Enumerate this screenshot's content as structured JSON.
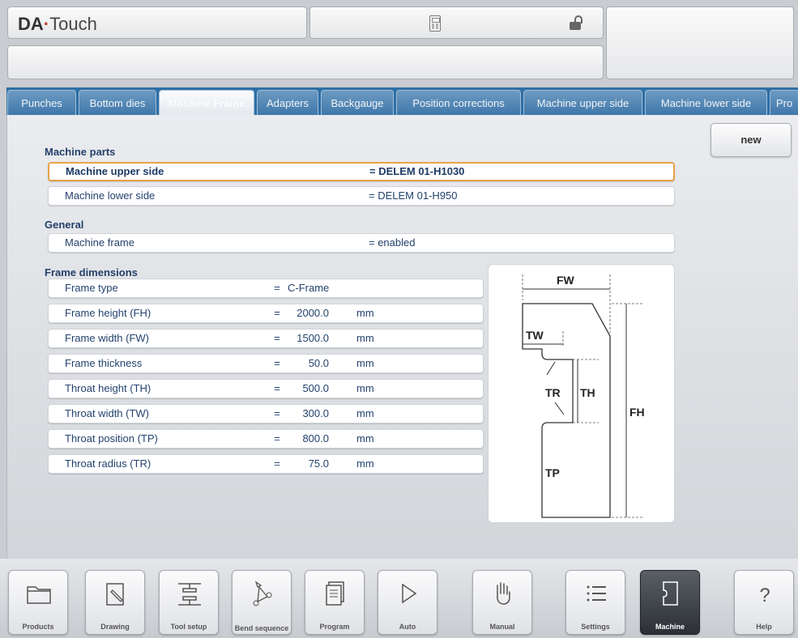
{
  "header": {
    "logo_brand": "DA",
    "logo_separator": "·",
    "logo_product": "Touch",
    "calculator_icon": "calculator-icon",
    "lock_icon": "unlocked-padlock-icon"
  },
  "tabs": [
    {
      "label": "Punches",
      "active": false
    },
    {
      "label": "Bottom dies",
      "active": false
    },
    {
      "label": "Machine Frame",
      "active": true
    },
    {
      "label": "Adapters",
      "active": false
    },
    {
      "label": "Backgauge",
      "active": false
    },
    {
      "label": "Position corrections",
      "active": false
    },
    {
      "label": "Machine upper side",
      "active": false
    },
    {
      "label": "Machine lower side",
      "active": false
    },
    {
      "label": "Pro",
      "active": false
    }
  ],
  "new_button": "new",
  "sections": {
    "machine_parts": {
      "heading": "Machine parts",
      "rows": [
        {
          "label": "Machine upper side",
          "value": "= DELEM 01-H1030",
          "selected": true
        },
        {
          "label": "Machine lower side",
          "value": "= DELEM 01-H950",
          "selected": false
        }
      ]
    },
    "general": {
      "heading": "General",
      "rows": [
        {
          "label": "Machine frame",
          "value": "= enabled"
        }
      ]
    },
    "frame_dimensions": {
      "heading": "Frame dimensions",
      "rows": [
        {
          "label": "Frame type",
          "eq": "=",
          "value": "C-Frame",
          "unit": ""
        },
        {
          "label": "Frame height (FH)",
          "eq": "=",
          "value": "2000.0",
          "unit": "mm"
        },
        {
          "label": "Frame width (FW)",
          "eq": "=",
          "value": "1500.0",
          "unit": "mm"
        },
        {
          "label": "Frame thickness",
          "eq": "=",
          "value": "50.0",
          "unit": "mm"
        },
        {
          "label": "Throat height (TH)",
          "eq": "=",
          "value": "500.0",
          "unit": "mm"
        },
        {
          "label": "Throat width (TW)",
          "eq": "=",
          "value": "300.0",
          "unit": "mm"
        },
        {
          "label": "Throat position (TP)",
          "eq": "=",
          "value": "800.0",
          "unit": "mm"
        },
        {
          "label": "Throat radius (TR)",
          "eq": "=",
          "value": "75.0",
          "unit": "mm"
        }
      ]
    }
  },
  "diagram": {
    "labels": {
      "fw": "FW",
      "tw": "TW",
      "tr": "TR",
      "th": "TH",
      "fh": "FH",
      "tp": "TP"
    }
  },
  "toolbar": [
    {
      "label": "Products",
      "icon": "folder-icon",
      "active": false
    },
    {
      "label": "Drawing",
      "icon": "pencil-document-icon",
      "active": false
    },
    {
      "label": "Tool setup",
      "icon": "tool-setup-icon",
      "active": false
    },
    {
      "label": "Bend sequence",
      "icon": "bend-sequence-icon",
      "active": false
    },
    {
      "label": "Program",
      "icon": "program-pages-icon",
      "active": false
    },
    {
      "label": "Auto",
      "icon": "play-icon",
      "active": false
    },
    {
      "label": "Manual",
      "icon": "hand-icon",
      "active": false
    },
    {
      "label": "Settings",
      "icon": "list-settings-icon",
      "active": false
    },
    {
      "label": "Machine",
      "icon": "machine-icon",
      "active": true
    },
    {
      "label": "Help",
      "icon": "help-icon",
      "active": false
    }
  ]
}
